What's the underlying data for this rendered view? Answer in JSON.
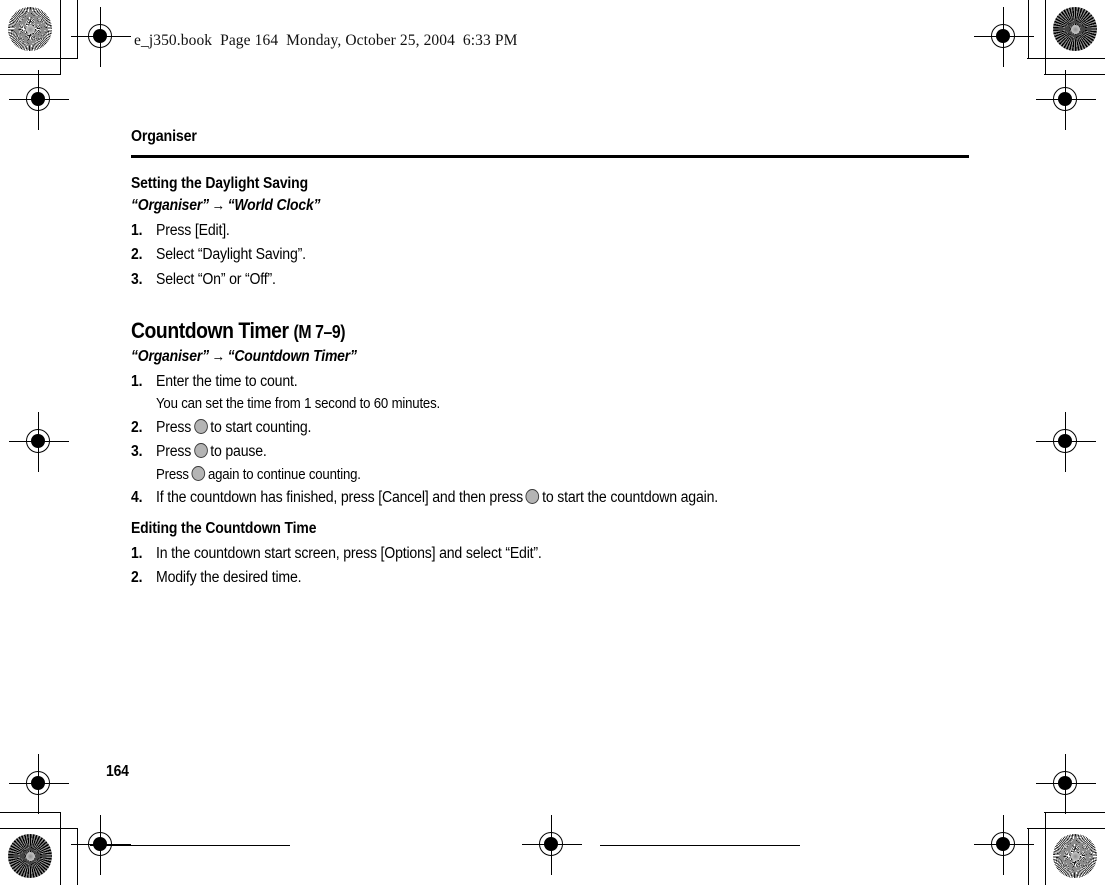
{
  "pdf_header": {
    "text": "e_j350.book  Page 164  Monday, October 25, 2004  6:33 PM"
  },
  "page": {
    "running_head": "Organiser",
    "page_number": "164"
  },
  "sections": [
    {
      "id": "daylight-saving",
      "heading": "Setting the Daylight Saving",
      "nav_path": {
        "from": "“Organiser”",
        "arrow": "→",
        "to": "“World Clock”"
      },
      "steps": [
        {
          "num": "1.",
          "text": "Press [Edit]."
        },
        {
          "num": "2.",
          "text": "Select “Daylight Saving”."
        },
        {
          "num": "3.",
          "text": "Select “On” or “Off”."
        }
      ]
    },
    {
      "id": "countdown-timer",
      "heading": "Countdown Timer",
      "heading_suffix": "(M 7–9)",
      "nav_path": {
        "from": "“Organiser”",
        "arrow": "→",
        "to": "“Countdown Timer”"
      },
      "steps": [
        {
          "num": "1.",
          "text": "Enter the time to count."
        },
        {
          "num": "2.",
          "pre": "Press",
          "post": "to start counting."
        },
        {
          "num": "3.",
          "pre": "Press",
          "post": "to pause."
        },
        {
          "num": "4.",
          "pre": "If the countdown has finished, press [Cancel] and then press",
          "post": "to start the countdown again."
        }
      ],
      "subnote": "You can set the time from 1 second to 60 minutes.",
      "substep": {
        "pre": "Press",
        "post": "again to continue counting."
      }
    },
    {
      "id": "editing-countdown-time",
      "heading": "Editing the Countdown Time",
      "steps": [
        {
          "num": "1.",
          "text": "In the countdown start screen, press [Options] and select “Edit”."
        },
        {
          "num": "2.",
          "text": "Modify the desired time."
        }
      ]
    }
  ],
  "icons": {
    "key_button": "center-key-icon",
    "registration_mark": "registration-crosshair-icon",
    "rosette_mark": "color-rosette-icon"
  },
  "colors": {
    "key_fill": "#b4b4b4",
    "key_border": "#3a3a3a",
    "rule": "#000000",
    "text": "#000000"
  }
}
